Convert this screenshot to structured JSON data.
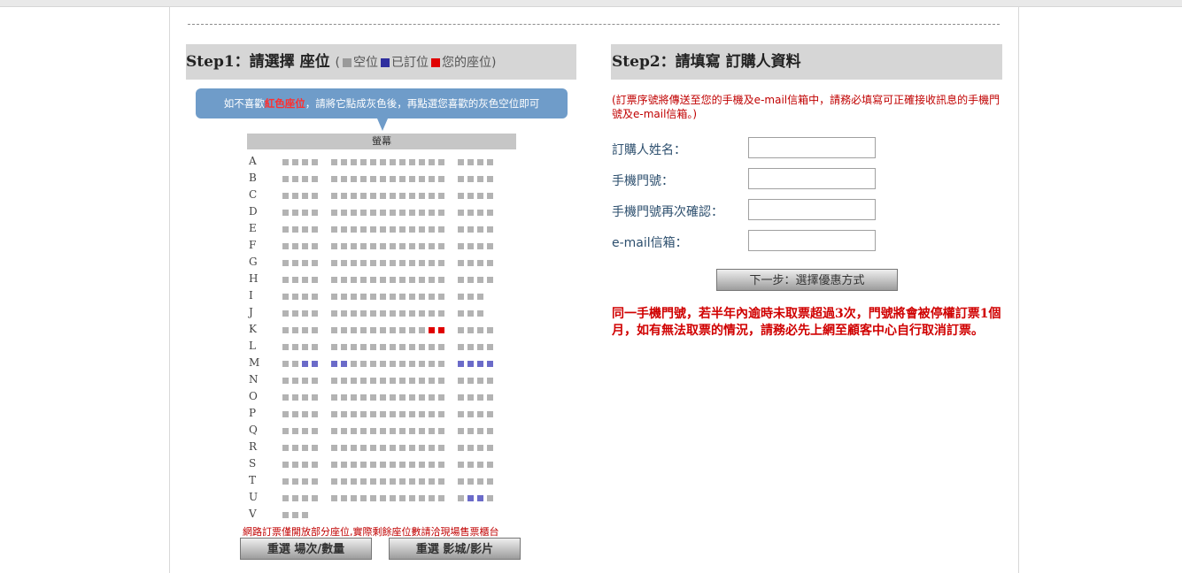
{
  "step1": {
    "title": "Step1：請選擇 座位",
    "legend": {
      "open": "空位",
      "booked": "已訂位",
      "yours": "您的座位"
    },
    "bubble": {
      "before": "如不喜歡",
      "red": "紅色座位",
      "after": "，請將它點成灰色後，再點選您喜歡的灰色空位即可"
    },
    "screen_label": "螢幕",
    "rows": [
      "A",
      "B",
      "C",
      "D",
      "E",
      "F",
      "G",
      "H",
      "I",
      "J",
      "K",
      "L",
      "M",
      "N",
      "O",
      "P",
      "Q",
      "R",
      "S",
      "T",
      "U",
      "V"
    ],
    "seat_map": [
      "oooo.oooooooooooo.oooo",
      "oooo.oooooooooooo.oooo",
      "oooo.oooooooooooo.oooo",
      "oooo.oooooooooooo.oooo",
      "oooo.oooooooooooo.oooo",
      "oooo.oooooooooooo.oooo",
      "oooo.oooooooooooo.oooo",
      "oooo.oooooooooooo.oooo",
      "oooo.oooooooooooo.ooo_",
      "oooo.oooooooooooo.ooo_",
      "oooo.ooooooooooyy.oooo",
      "oooo.oooooooooooo.oooo",
      "oobb.bboooooooooo.bbbb",
      "oooo.oooooooooooo.oooo",
      "oooo.oooooooooooo.oooo",
      "oooo.oooooooooooo.oooo",
      "oooo.oooooooooooo.oooo",
      "oooo.oooooooooooo.oooo",
      "oooo.oooooooooooo.oooo",
      "oooo.oooooooooooo.oooo",
      "oooo.oooooooooooo.obbo",
      "ooo_.____________.____"
    ],
    "note": "網路訂票僅開放部分座位,實際剩餘座位數請洽現場售票櫃台",
    "btn_reselect_session": "重選  場次/數量",
    "btn_reselect_cinema": "重選  影城/影片"
  },
  "step2": {
    "title": "Step2：請填寫 訂購人資料",
    "notice": "(訂票序號將傳送至您的手機及e-mail信箱中，請務必填寫可正確接收訊息的手機門號及e-mail信箱。)",
    "fields": [
      {
        "label": "訂購人姓名：",
        "value": ""
      },
      {
        "label": "手機門號：",
        "value": ""
      },
      {
        "label": "手機門號再次確認：",
        "value": ""
      },
      {
        "label": "e-mail信箱：",
        "value": ""
      }
    ],
    "next_button": "下一步：選擇優惠方式",
    "warning": "同一手機門號，若半年內逾時未取票超過3次，門號將會被停權訂票1個月，如有無法取票的情況，請務必先上網至顧客中心自行取消訂票。"
  },
  "colors": {
    "open": "#b3b3b3",
    "booked": "#6b6bc9",
    "yours": "#e00000",
    "bubble": "#6f9cc9",
    "warning": "#d00000"
  }
}
